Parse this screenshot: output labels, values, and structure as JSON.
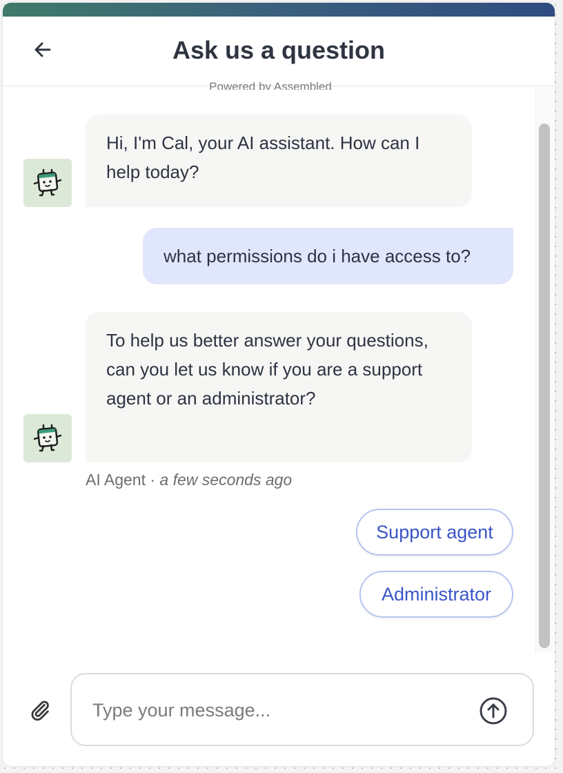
{
  "header": {
    "title": "Ask us a question",
    "back_icon": "arrow-left-icon"
  },
  "powered_by": {
    "prefix": "Powered by",
    "brand": "Assembled"
  },
  "messages": [
    {
      "sender": "bot",
      "text": "Hi, I'm Cal, your AI assistant. How can I help today?",
      "avatar_icon": "robot-mascot-icon"
    },
    {
      "sender": "user",
      "text": "what permissions do i have access to?"
    },
    {
      "sender": "bot",
      "text": "To help us better answer your questions, can you let us know if you are a support agent or an administrator?",
      "avatar_icon": "robot-mascot-icon"
    }
  ],
  "meta": {
    "author": "AI Agent",
    "separator": "·",
    "time": "a few seconds ago"
  },
  "quick_replies": [
    {
      "label": "Support agent"
    },
    {
      "label": "Administrator"
    }
  ],
  "composer": {
    "placeholder": "Type your message...",
    "value": "",
    "attach_icon": "paperclip-icon",
    "send_icon": "arrow-up-circle-icon"
  },
  "colors": {
    "accent": "#3a55c6",
    "user_bubble": "#e0e6fb",
    "bot_bubble": "#f6f6f4",
    "avatar_bg": "#dce9d8",
    "title_text": "#2f3441"
  }
}
